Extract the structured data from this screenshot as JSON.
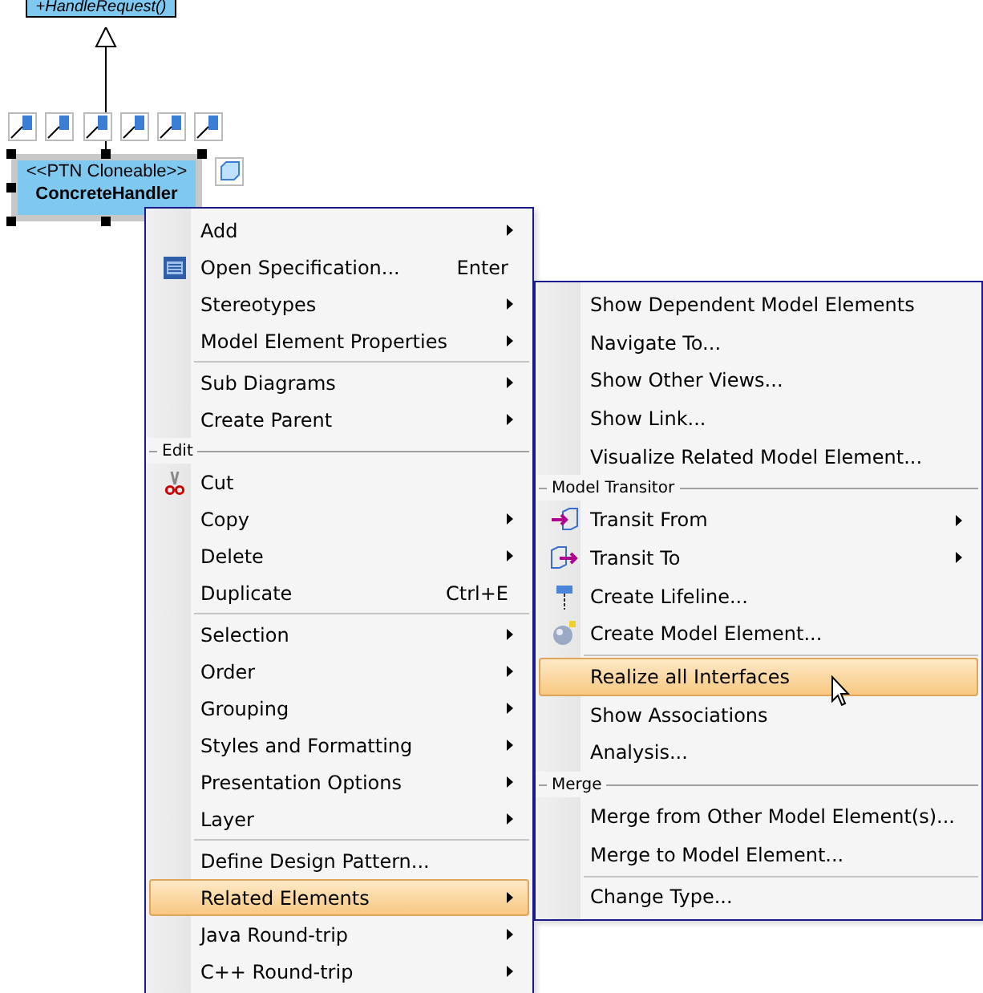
{
  "diagram": {
    "parent_class": {
      "operation": "+HandleRequest()"
    },
    "selected_class": {
      "stereotype": "<<PTN Cloneable>>",
      "name": "ConcreteHandler"
    }
  },
  "context_menu": {
    "items": [
      {
        "kind": "item",
        "label": "Add",
        "submenu": true,
        "selected": false
      },
      {
        "kind": "item",
        "label": "Open Specification...",
        "shortcut": "Enter",
        "submenu": false,
        "selected": false
      },
      {
        "kind": "item",
        "label": "Stereotypes",
        "submenu": true,
        "selected": false
      },
      {
        "kind": "item",
        "label": "Model Element Properties",
        "submenu": true,
        "selected": false
      },
      {
        "kind": "separator"
      },
      {
        "kind": "item",
        "label": "Sub Diagrams",
        "submenu": true,
        "selected": false
      },
      {
        "kind": "item",
        "label": "Create Parent",
        "submenu": true,
        "selected": false
      },
      {
        "kind": "header",
        "label": "Edit"
      },
      {
        "kind": "item",
        "label": "Cut",
        "submenu": false,
        "selected": false
      },
      {
        "kind": "item",
        "label": "Copy",
        "submenu": true,
        "selected": false
      },
      {
        "kind": "item",
        "label": "Delete",
        "submenu": true,
        "selected": false
      },
      {
        "kind": "item",
        "label": "Duplicate",
        "shortcut": "Ctrl+E",
        "submenu": false,
        "selected": false
      },
      {
        "kind": "separator"
      },
      {
        "kind": "item",
        "label": "Selection",
        "submenu": true,
        "selected": false
      },
      {
        "kind": "item",
        "label": "Order",
        "submenu": true,
        "selected": false
      },
      {
        "kind": "item",
        "label": "Grouping",
        "submenu": true,
        "selected": false
      },
      {
        "kind": "item",
        "label": "Styles and Formatting",
        "submenu": true,
        "selected": false
      },
      {
        "kind": "item",
        "label": "Presentation Options",
        "submenu": true,
        "selected": false
      },
      {
        "kind": "item",
        "label": "Layer",
        "submenu": true,
        "selected": false
      },
      {
        "kind": "separator"
      },
      {
        "kind": "item",
        "label": "Define Design Pattern...",
        "submenu": false,
        "selected": false
      },
      {
        "kind": "item",
        "label": "Related Elements",
        "submenu": true,
        "selected": true
      },
      {
        "kind": "item",
        "label": "Java Round-trip",
        "submenu": true,
        "selected": false
      },
      {
        "kind": "item",
        "label": "C++ Round-trip",
        "submenu": true,
        "selected": false
      }
    ]
  },
  "submenu": {
    "items": [
      {
        "kind": "item",
        "label": "Show Dependent Model Elements",
        "submenu": false,
        "selected": false
      },
      {
        "kind": "item",
        "label": "Navigate To...",
        "submenu": false,
        "selected": false
      },
      {
        "kind": "item",
        "label": "Show Other Views...",
        "submenu": false,
        "selected": false
      },
      {
        "kind": "item",
        "label": "Show Link...",
        "submenu": false,
        "selected": false
      },
      {
        "kind": "item",
        "label": "Visualize Related Model Element...",
        "submenu": false,
        "selected": false
      },
      {
        "kind": "header",
        "label": "Model Transitor"
      },
      {
        "kind": "item",
        "label": "Transit From",
        "submenu": true,
        "selected": false
      },
      {
        "kind": "item",
        "label": "Transit To",
        "submenu": true,
        "selected": false
      },
      {
        "kind": "item",
        "label": "Create Lifeline...",
        "submenu": false,
        "selected": false
      },
      {
        "kind": "item",
        "label": "Create Model Element...",
        "submenu": false,
        "selected": false
      },
      {
        "kind": "separator"
      },
      {
        "kind": "item",
        "label": "Realize all Interfaces",
        "submenu": false,
        "selected": true
      },
      {
        "kind": "item",
        "label": "Show Associations",
        "submenu": false,
        "selected": false
      },
      {
        "kind": "item",
        "label": "Analysis...",
        "submenu": false,
        "selected": false
      },
      {
        "kind": "header",
        "label": "Merge"
      },
      {
        "kind": "item",
        "label": "Merge from Other Model Element(s)...",
        "submenu": false,
        "selected": false
      },
      {
        "kind": "item",
        "label": "Merge to Model Element...",
        "submenu": false,
        "selected": false
      },
      {
        "kind": "separator"
      },
      {
        "kind": "item",
        "label": "Change Type...",
        "submenu": false,
        "selected": false
      }
    ]
  }
}
